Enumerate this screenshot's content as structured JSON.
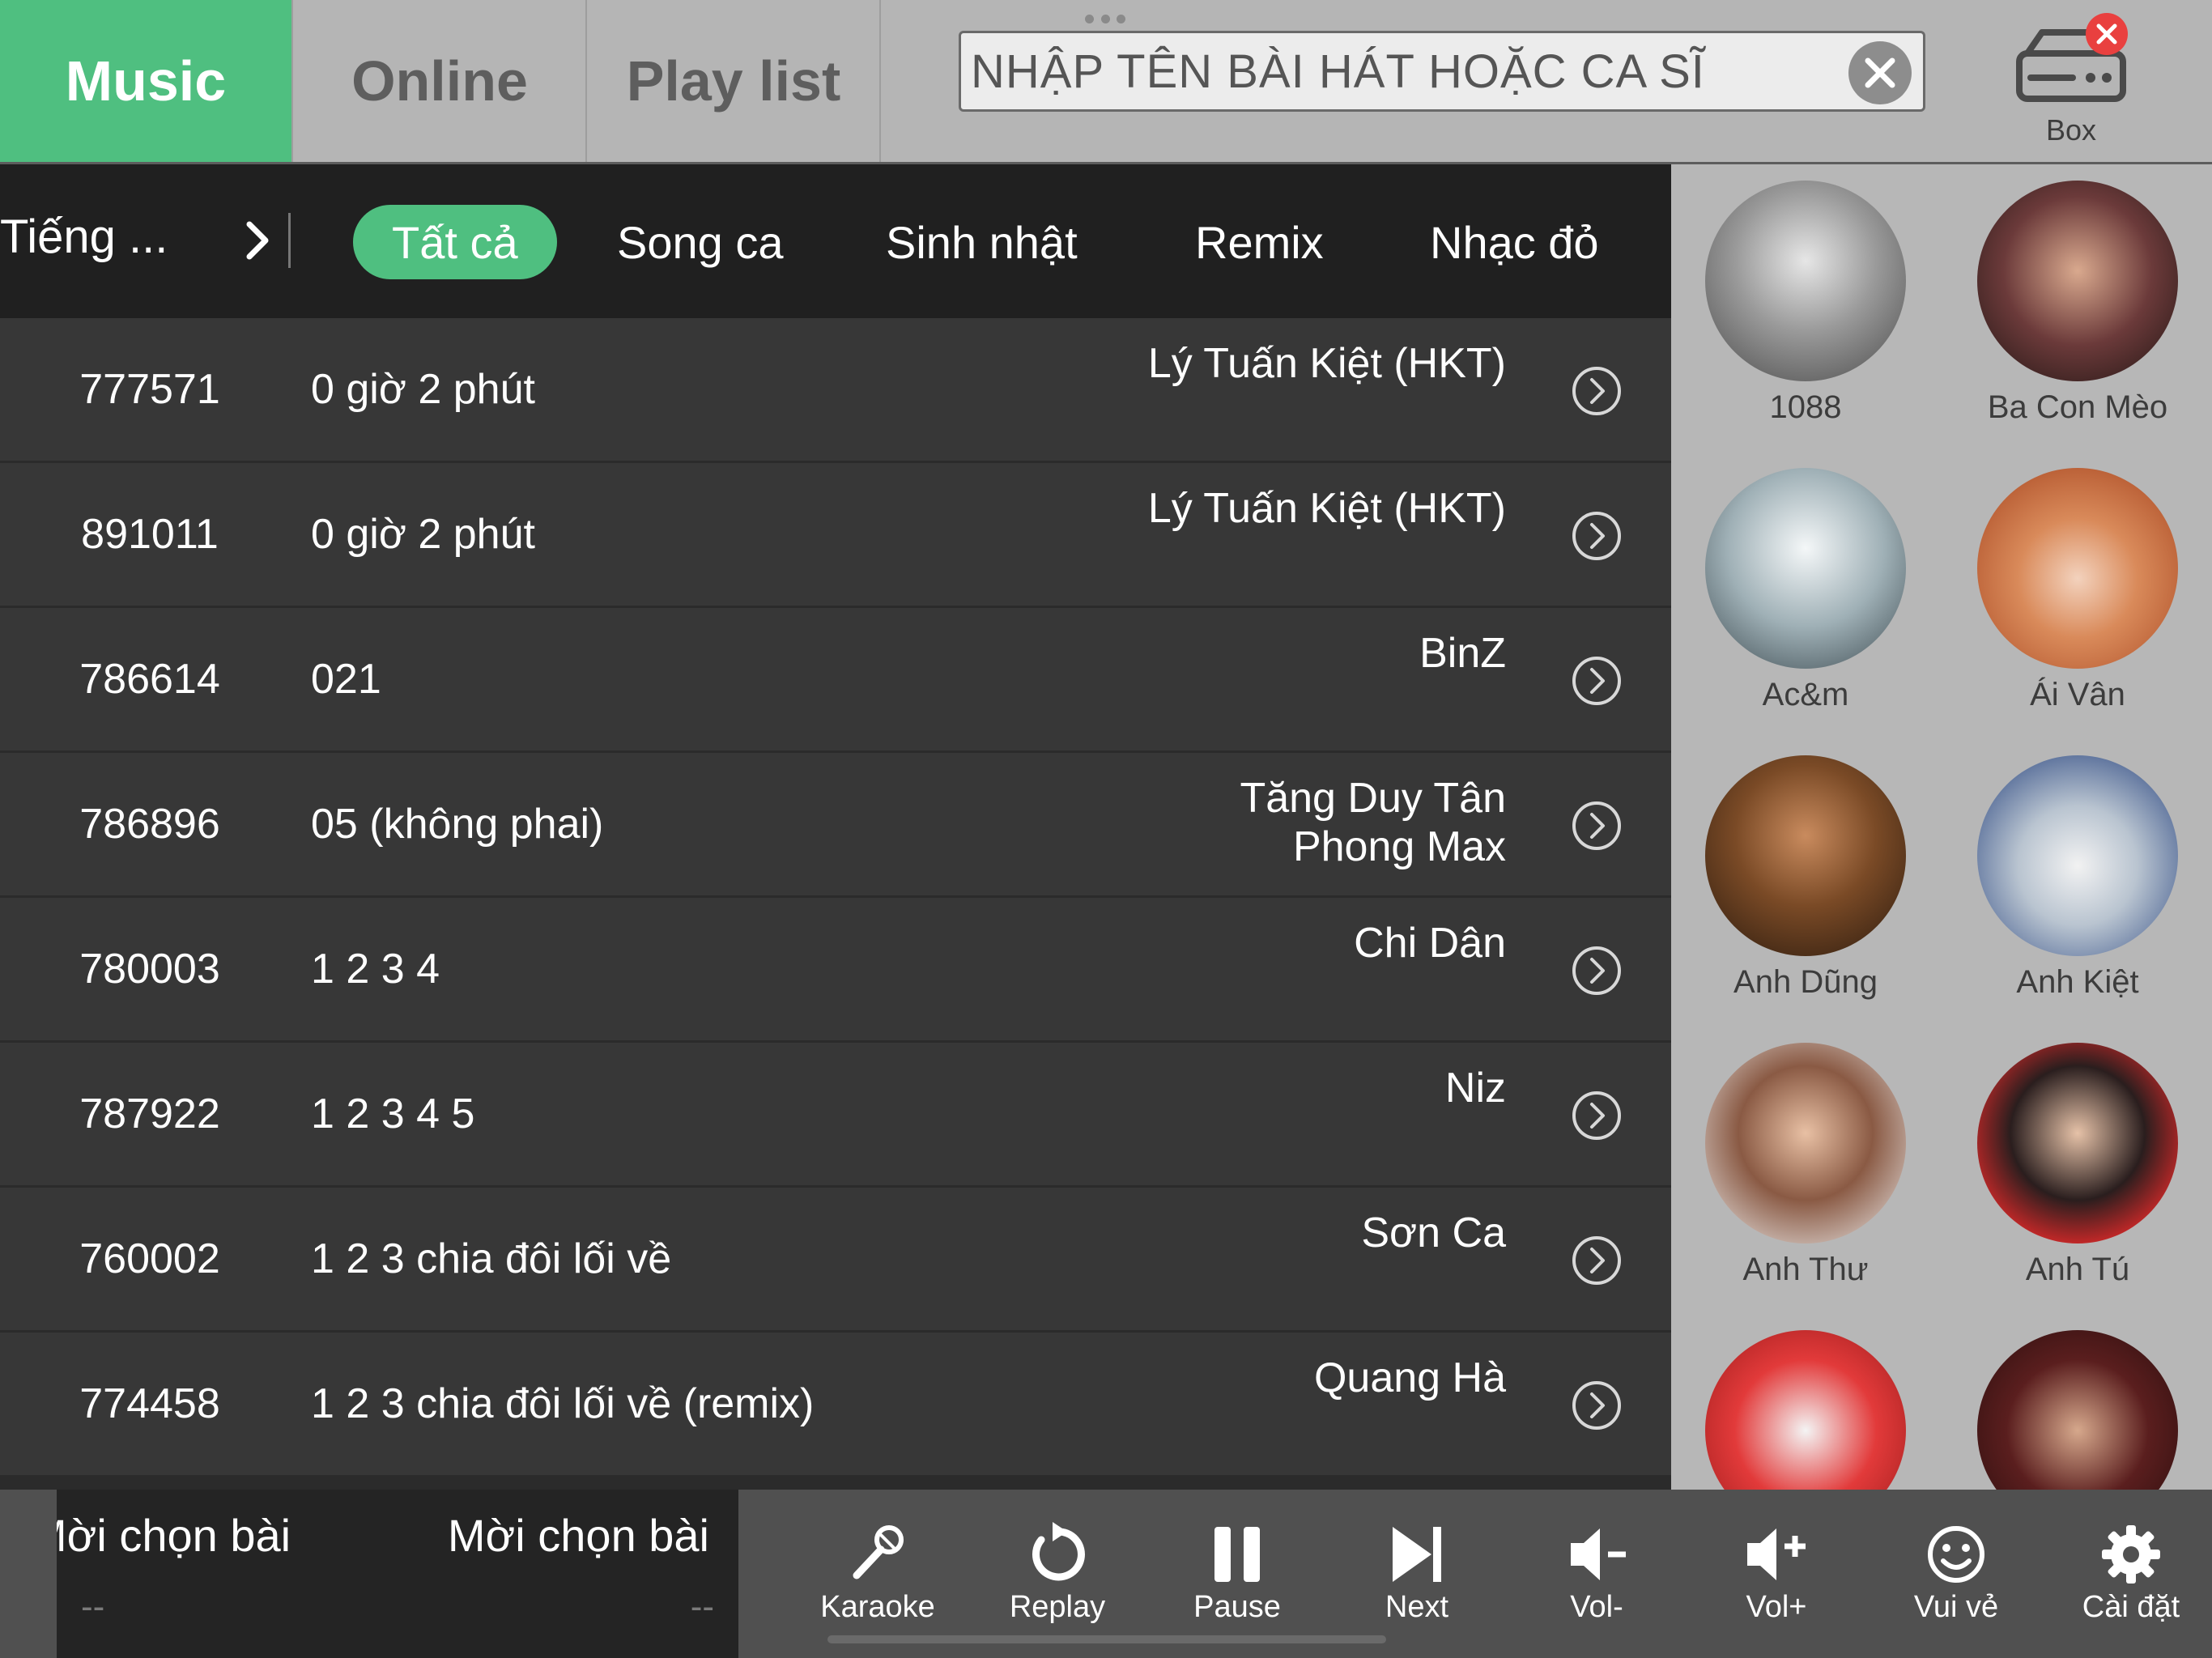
{
  "tabs": [
    {
      "label": "Music",
      "active": true
    },
    {
      "label": "Online",
      "active": false
    },
    {
      "label": "Play list",
      "active": false
    }
  ],
  "search": {
    "placeholder": "NHẬP TÊN BÀI HÁT HOẶC CA SĨ",
    "value": ""
  },
  "box": {
    "label": "Box",
    "icon": "karaoke-box-icon",
    "badge_icon": "close-icon"
  },
  "categories": {
    "language": "Tiếng ...",
    "items": [
      {
        "label": "Tất cả",
        "active": true
      },
      {
        "label": "Song ca",
        "active": false
      },
      {
        "label": "Sinh nhật",
        "active": false
      },
      {
        "label": "Remix",
        "active": false
      },
      {
        "label": "Nhạc đỏ",
        "active": false
      }
    ]
  },
  "songs": [
    {
      "id": "777571",
      "title": "0 giờ 2 phút",
      "artist": "Lý Tuấn Kiệt (HKT)"
    },
    {
      "id": "891011",
      "title": "0 giờ 2 phút",
      "artist": "Lý Tuấn Kiệt (HKT)"
    },
    {
      "id": "786614",
      "title": "021",
      "artist": "BinZ"
    },
    {
      "id": "786896",
      "title": "05 (không phai)",
      "artist": "Tăng Duy Tân\nPhong Max"
    },
    {
      "id": "780003",
      "title": "1 2 3 4",
      "artist": "Chi Dân"
    },
    {
      "id": "787922",
      "title": "1 2 3 4 5",
      "artist": "Niz"
    },
    {
      "id": "760002",
      "title": "1 2 3 chia đôi lối về",
      "artist": "Sơn Ca"
    },
    {
      "id": "774458",
      "title": "1 2 3 chia đôi lối về (remix)",
      "artist": "Quang Hà"
    }
  ],
  "singers": [
    {
      "name": "1088"
    },
    {
      "name": "Ba Con Mèo"
    },
    {
      "name": "Ac&m"
    },
    {
      "name": "Ái Vân"
    },
    {
      "name": "Anh Dũng"
    },
    {
      "name": "Anh Kiệt"
    },
    {
      "name": "Anh Thư"
    },
    {
      "name": "Anh Tú"
    },
    {
      "name": ""
    },
    {
      "name": ""
    }
  ],
  "now_playing": {
    "current": "Mời chọn bài",
    "current_sub": "--",
    "next": "Mời chọn bài",
    "next_sub": "--"
  },
  "controls": [
    {
      "label": "Karaoke",
      "icon": "microphone-icon"
    },
    {
      "label": "Replay",
      "icon": "replay-icon"
    },
    {
      "label": "Pause",
      "icon": "pause-icon"
    },
    {
      "label": "Next",
      "icon": "skip-next-icon"
    },
    {
      "label": "Vol-",
      "icon": "volume-down-icon"
    },
    {
      "label": "Vol+",
      "icon": "volume-up-icon"
    },
    {
      "label": "Vui vẻ",
      "icon": "smiley-icon"
    },
    {
      "label": "Cài đặt",
      "icon": "gear-icon"
    }
  ],
  "colors": {
    "accent": "#4fbf80",
    "badge": "#e9403f"
  }
}
